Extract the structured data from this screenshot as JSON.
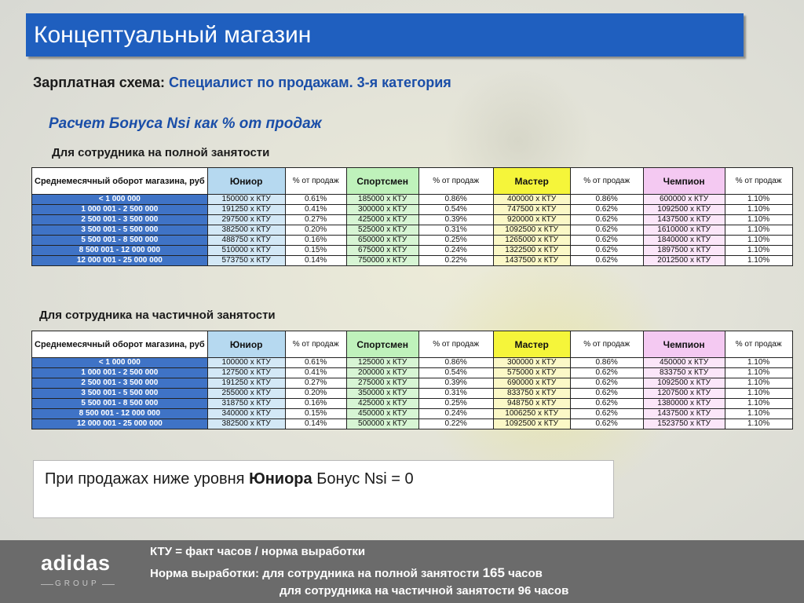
{
  "header": {
    "title": "Концептуальный магазин"
  },
  "subtitle": {
    "prefix": "Зарплатная схема:",
    "accent": "Специалист по продажам. 3-я категория"
  },
  "bonus_title": "Расчет Бонуса Nsi как % от продаж",
  "columns": {
    "range": "Среднемесячный оборот магазина, руб",
    "junior": "Юниор",
    "sport": "Спортсмен",
    "master": "Мастер",
    "champion": "Чемпион",
    "pct": "% от продаж"
  },
  "full_time": {
    "caption": "Для сотрудника на полной занятости",
    "rows": [
      {
        "range": "< 1 000 000",
        "junior": "150000 x КТУ",
        "junior_pct": "0.61%",
        "sport": "185000 x КТУ",
        "sport_pct": "0.86%",
        "master": "400000 x КТУ",
        "master_pct": "0.86%",
        "champion": "600000 x КТУ",
        "champion_pct": "1.10%"
      },
      {
        "range": "1 000 001 - 2 500 000",
        "junior": "191250 x КТУ",
        "junior_pct": "0.41%",
        "sport": "300000 x КТУ",
        "sport_pct": "0.54%",
        "master": "747500 x КТУ",
        "master_pct": "0.62%",
        "champion": "1092500 x КТУ",
        "champion_pct": "1.10%"
      },
      {
        "range": "2 500 001 - 3 500 000",
        "junior": "297500 x КТУ",
        "junior_pct": "0.27%",
        "sport": "425000 x КТУ",
        "sport_pct": "0.39%",
        "master": "920000 x КТУ",
        "master_pct": "0.62%",
        "champion": "1437500 x КТУ",
        "champion_pct": "1.10%"
      },
      {
        "range": "3 500 001 - 5 500 000",
        "junior": "382500 x КТУ",
        "junior_pct": "0.20%",
        "sport": "525000 x КТУ",
        "sport_pct": "0.31%",
        "master": "1092500 x КТУ",
        "master_pct": "0.62%",
        "champion": "1610000 x КТУ",
        "champion_pct": "1.10%"
      },
      {
        "range": "5 500 001 - 8 500 000",
        "junior": "488750 x КТУ",
        "junior_pct": "0.16%",
        "sport": "650000 x КТУ",
        "sport_pct": "0.25%",
        "master": "1265000 x КТУ",
        "master_pct": "0.62%",
        "champion": "1840000 x КТУ",
        "champion_pct": "1.10%"
      },
      {
        "range": "8 500 001 - 12 000 000",
        "junior": "510000 x КТУ",
        "junior_pct": "0.15%",
        "sport": "675000 x КТУ",
        "sport_pct": "0.24%",
        "master": "1322500 x КТУ",
        "master_pct": "0.62%",
        "champion": "1897500 x КТУ",
        "champion_pct": "1.10%"
      },
      {
        "range": "12 000 001 - 25 000 000",
        "junior": "573750 x КТУ",
        "junior_pct": "0.14%",
        "sport": "750000 x КТУ",
        "sport_pct": "0.22%",
        "master": "1437500 x КТУ",
        "master_pct": "0.62%",
        "champion": "2012500 x КТУ",
        "champion_pct": "1.10%"
      }
    ]
  },
  "part_time": {
    "caption": "Для сотрудника на частичной занятости",
    "rows": [
      {
        "range": "< 1 000 000",
        "junior": "100000 x КТУ",
        "junior_pct": "0.61%",
        "sport": "125000 x КТУ",
        "sport_pct": "0.86%",
        "master": "300000 x КТУ",
        "master_pct": "0.86%",
        "champion": "450000 x КТУ",
        "champion_pct": "1.10%"
      },
      {
        "range": "1 000 001 - 2 500 000",
        "junior": "127500 x КТУ",
        "junior_pct": "0.41%",
        "sport": "200000 x КТУ",
        "sport_pct": "0.54%",
        "master": "575000 x КТУ",
        "master_pct": "0.62%",
        "champion": "833750 x КТУ",
        "champion_pct": "1.10%"
      },
      {
        "range": "2 500 001 - 3 500 000",
        "junior": "191250 x КТУ",
        "junior_pct": "0.27%",
        "sport": "275000 x КТУ",
        "sport_pct": "0.39%",
        "master": "690000 x КТУ",
        "master_pct": "0.62%",
        "champion": "1092500 x КТУ",
        "champion_pct": "1.10%"
      },
      {
        "range": "3 500 001 - 5 500 000",
        "junior": "255000 x КТУ",
        "junior_pct": "0.20%",
        "sport": "350000 x КТУ",
        "sport_pct": "0.31%",
        "master": "833750 x КТУ",
        "master_pct": "0.62%",
        "champion": "1207500 x КТУ",
        "champion_pct": "1.10%"
      },
      {
        "range": "5 500 001 - 8 500 000",
        "junior": "318750 x КТУ",
        "junior_pct": "0.16%",
        "sport": "425000 x КТУ",
        "sport_pct": "0.25%",
        "master": "948750 x КТУ",
        "master_pct": "0.62%",
        "champion": "1380000 x КТУ",
        "champion_pct": "1.10%"
      },
      {
        "range": "8 500 001 - 12 000 000",
        "junior": "340000 x КТУ",
        "junior_pct": "0.15%",
        "sport": "450000 x КТУ",
        "sport_pct": "0.24%",
        "master": "1006250 x КТУ",
        "master_pct": "0.62%",
        "champion": "1437500 x КТУ",
        "champion_pct": "1.10%"
      },
      {
        "range": "12 000 001 - 25 000 000",
        "junior": "382500 x КТУ",
        "junior_pct": "0.14%",
        "sport": "500000 x КТУ",
        "sport_pct": "0.22%",
        "master": "1092500 x КТУ",
        "master_pct": "0.62%",
        "champion": "1523750 x КТУ",
        "champion_pct": "1.10%"
      }
    ]
  },
  "note": {
    "prefix": "При продажах ниже уровня",
    "bold": "Юниора",
    "suffix": "Бонус Nsi = 0"
  },
  "footer": {
    "logo_word": "adidas",
    "logo_sub": "GROUP",
    "line1": "КТУ = факт часов / норма выработки",
    "line2_text": "Норма выработки: для сотрудника на полной занятости",
    "line2_value": "165",
    "line2_unit": "часов",
    "line3": "для сотрудника на частичной занятости 96 часов"
  },
  "colors": {
    "header": "#1f5fbf",
    "range_cell": "#3f73c6",
    "junior": "#b6d9f0",
    "sport": "#bff2bb",
    "master": "#f5f53a",
    "champion": "#f4c9f2",
    "footer": "#6b6b6b"
  }
}
